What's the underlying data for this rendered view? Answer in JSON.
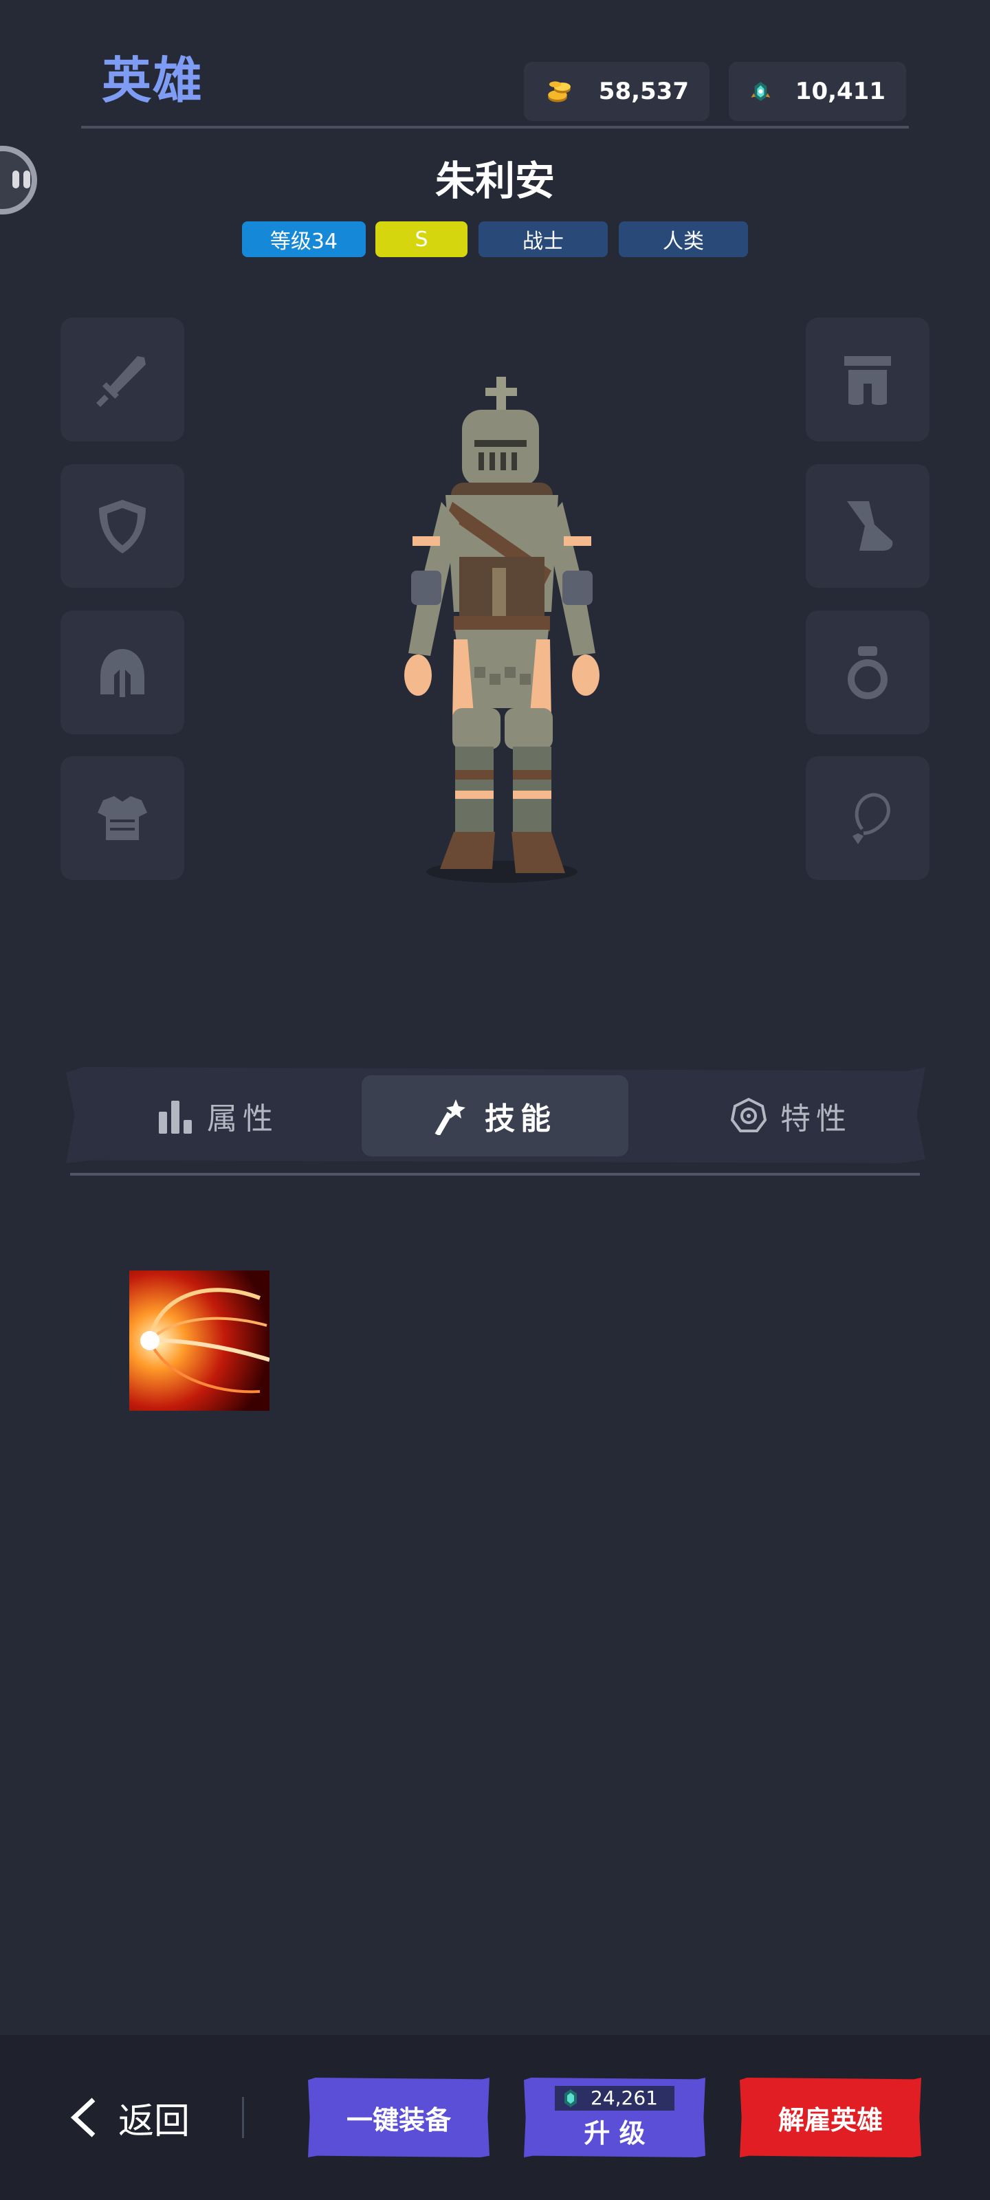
{
  "header": {
    "title": "英雄",
    "gold": "58,537",
    "gems": "10,411"
  },
  "hero": {
    "name": "朱利安",
    "tags": [
      {
        "label": "等级34",
        "color": "#1589d8"
      },
      {
        "label": "S",
        "color": "#d6d60e"
      },
      {
        "label": "战士",
        "color": "#294a78"
      },
      {
        "label": "人类",
        "color": "#294a78"
      }
    ]
  },
  "slots": {
    "left": [
      "sword-icon",
      "shield-icon",
      "helmet-icon",
      "armor-icon"
    ],
    "right": [
      "pants-icon",
      "boot-icon",
      "ring-icon",
      "necklace-icon"
    ]
  },
  "tabs": [
    {
      "label": "属性",
      "icon": "bar-chart-icon",
      "active": false
    },
    {
      "label": "技能",
      "icon": "magic-wand-icon",
      "active": true
    },
    {
      "label": "特性",
      "icon": "trait-badge-icon",
      "active": false
    }
  ],
  "skills": [
    {
      "icon": "fire-slash-icon"
    }
  ],
  "footer": {
    "back_label": "返回",
    "equip_all_label": "一键装备",
    "upgrade_cost": "24,261",
    "upgrade_label": "升 级",
    "dismiss_label": "解雇英雄"
  },
  "colors": {
    "background": "#262a36",
    "accent_title": "#7f9cf5",
    "button_primary": "#5a4fd6",
    "button_danger": "#e01e24"
  }
}
